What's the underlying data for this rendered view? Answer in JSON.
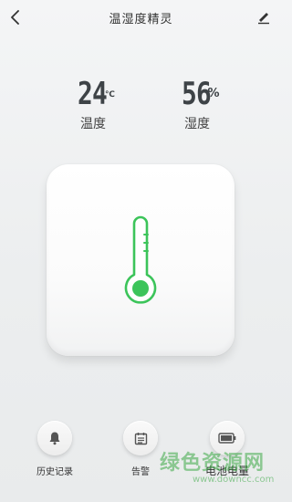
{
  "header": {
    "title": "温湿度精灵"
  },
  "readings": {
    "temperature": {
      "value": "24",
      "unit": "℃",
      "label": "温度"
    },
    "humidity": {
      "value": "56",
      "unit": "%",
      "label": "湿度"
    }
  },
  "card": {
    "icon": "thermometer-icon",
    "accent": "#3cc45a"
  },
  "bottom": {
    "history_label": "历史记录",
    "alarm_label": "告警",
    "battery_label": "电池电量"
  },
  "watermark": {
    "text": "绿色资源网",
    "url": "www.downcc.com"
  },
  "colors": {
    "accent": "#3cc45a",
    "text": "#333333",
    "value": "#3e4347"
  }
}
